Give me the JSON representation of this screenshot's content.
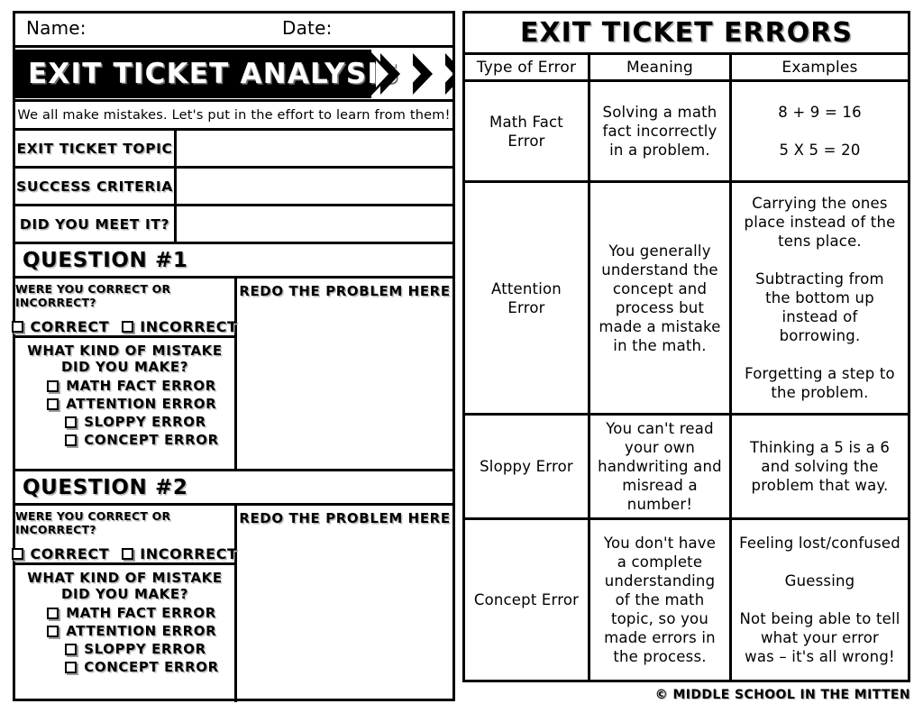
{
  "worksheet": {
    "name_label": "Name:",
    "date_label": "Date:",
    "banner_title": "EXIT TICKET ANALYSIS",
    "tagline": "We all make mistakes. Let's put in the effort to learn from them!",
    "fields": [
      {
        "label": "EXIT TICKET TOPIC",
        "value": ""
      },
      {
        "label": "SUCCESS CRITERIA",
        "value": ""
      },
      {
        "label": "DID YOU MEET IT?",
        "value": ""
      }
    ],
    "questions": [
      {
        "header": "QUESTION #1",
        "correct_prompt": "WERE YOU CORRECT OR INCORRECT?",
        "correct_options": [
          "CORRECT",
          "INCORRECT"
        ],
        "mistake_prompt": "WHAT KIND OF MISTAKE DID YOU MAKE?",
        "mistake_options": [
          "MATH FACT ERROR",
          "ATTENTION ERROR",
          "SLOPPY ERROR",
          "CONCEPT ERROR"
        ],
        "redo_label": "REDO THE PROBLEM HERE",
        "redo_value": ""
      },
      {
        "header": "QUESTION #2",
        "correct_prompt": "WERE YOU CORRECT OR INCORRECT?",
        "correct_options": [
          "CORRECT",
          "INCORRECT"
        ],
        "mistake_prompt": "WHAT KIND OF MISTAKE DID YOU MAKE?",
        "mistake_options": [
          "MATH FACT ERROR",
          "ATTENTION ERROR",
          "SLOPPY ERROR",
          "CONCEPT ERROR"
        ],
        "redo_label": "REDO THE PROBLEM HERE",
        "redo_value": ""
      }
    ]
  },
  "reference": {
    "title": "EXIT TICKET ERRORS",
    "columns": [
      "Type of Error",
      "Meaning",
      "Examples"
    ],
    "rows": [
      {
        "type": "Math Fact\nError",
        "meaning": "Solving a math\nfact incorrectly\nin a problem.",
        "examples": "8 + 9 = 16\n\n5 X 5 = 20"
      },
      {
        "type": "Attention Error",
        "meaning": "You generally\nunderstand the\nconcept and\nprocess but\nmade a mistake\nin the math.",
        "examples": "Carrying the ones\nplace instead of the\ntens place.\n\nSubtracting from\nthe bottom up\ninstead of\nborrowing.\n\nForgetting a step to\nthe problem."
      },
      {
        "type": "Sloppy Error",
        "meaning": "You can't read\nyour own\nhandwriting and\nmisread a\nnumber!",
        "examples": "Thinking a 5 is a 6\nand solving the\nproblem that way."
      },
      {
        "type": "Concept Error",
        "meaning": "You don't have\na complete\nunderstanding\nof the math\ntopic, so you\nmade errors in\nthe process.",
        "examples": "Feeling lost/confused\n\nGuessing\n\nNot being able to tell\nwhat your error\nwas – it's all wrong!"
      }
    ]
  },
  "footer": {
    "copyright": "© MIDDLE SCHOOL IN THE MITTEN"
  },
  "colors": {
    "ink": "#000000",
    "paper": "#ffffff",
    "shadow": "#b0b0b0"
  }
}
